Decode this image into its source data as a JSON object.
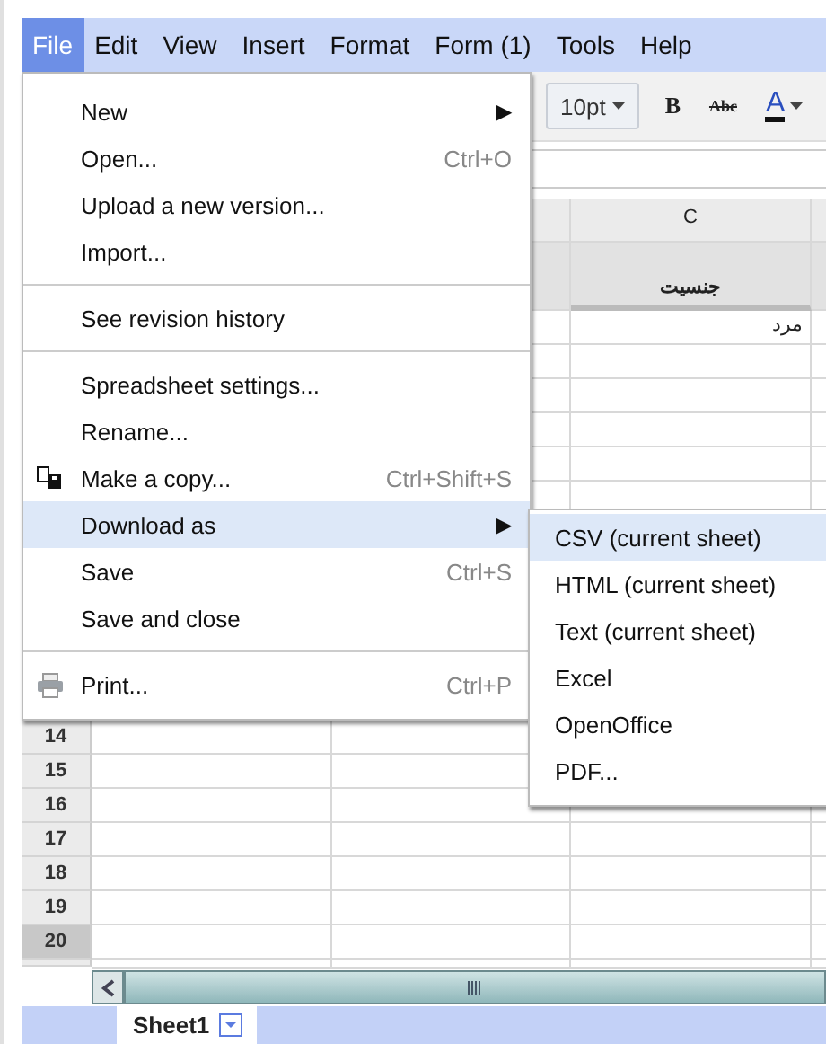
{
  "menubar": [
    {
      "label": "File",
      "selected": true
    },
    {
      "label": "Edit",
      "selected": false
    },
    {
      "label": "View",
      "selected": false
    },
    {
      "label": "Insert",
      "selected": false
    },
    {
      "label": "Format",
      "selected": false
    },
    {
      "label": "Form (1)",
      "selected": false
    },
    {
      "label": "Tools",
      "selected": false
    },
    {
      "label": "Help",
      "selected": false
    }
  ],
  "toolbar": {
    "font_size": "10pt",
    "bold": "B",
    "strikethrough": "Abc",
    "text_color": "A"
  },
  "sheet": {
    "column_header": "C",
    "header_cell": "جنسیت",
    "cell": "مرد",
    "row_numbers": [
      {
        "label": "14",
        "selected": false
      },
      {
        "label": "15",
        "selected": false
      },
      {
        "label": "16",
        "selected": false
      },
      {
        "label": "17",
        "selected": false
      },
      {
        "label": "18",
        "selected": false
      },
      {
        "label": "19",
        "selected": false
      },
      {
        "label": "20",
        "selected": true
      }
    ]
  },
  "file_menu": [
    {
      "kind": "item",
      "label": "New",
      "arrow": "▶",
      "selected": false
    },
    {
      "kind": "item",
      "label": "Open...",
      "shortcut": "Ctrl+O",
      "selected": false
    },
    {
      "kind": "item",
      "label": "Upload a new version...",
      "selected": false
    },
    {
      "kind": "item",
      "label": "Import...",
      "selected": false
    },
    {
      "kind": "separator"
    },
    {
      "kind": "item",
      "label": "See revision history",
      "selected": false
    },
    {
      "kind": "separator"
    },
    {
      "kind": "item",
      "label": "Spreadsheet settings...",
      "selected": false
    },
    {
      "kind": "item",
      "label": "Rename...",
      "selected": false
    },
    {
      "kind": "copy",
      "label": "Make a copy...",
      "shortcut": "Ctrl+Shift+S",
      "selected": false
    },
    {
      "kind": "item",
      "label": "Download as",
      "arrow": "▶",
      "selected": true
    },
    {
      "kind": "item",
      "label": "Save",
      "shortcut": "Ctrl+S",
      "selected": false
    },
    {
      "kind": "item",
      "label": "Save and close",
      "selected": false
    },
    {
      "kind": "separator"
    },
    {
      "kind": "print",
      "label": "Print...",
      "shortcut": "Ctrl+P",
      "selected": false
    }
  ],
  "download_menu": [
    {
      "label": "CSV (current sheet)",
      "selected": true
    },
    {
      "label": "HTML (current sheet)",
      "selected": false
    },
    {
      "label": "Text (current sheet)",
      "selected": false
    },
    {
      "label": "Excel",
      "selected": false
    },
    {
      "label": "OpenOffice",
      "selected": false
    },
    {
      "label": "PDF...",
      "selected": false
    }
  ],
  "sheet_tabs": [
    {
      "label": "Sheet1",
      "selected": true
    }
  ]
}
